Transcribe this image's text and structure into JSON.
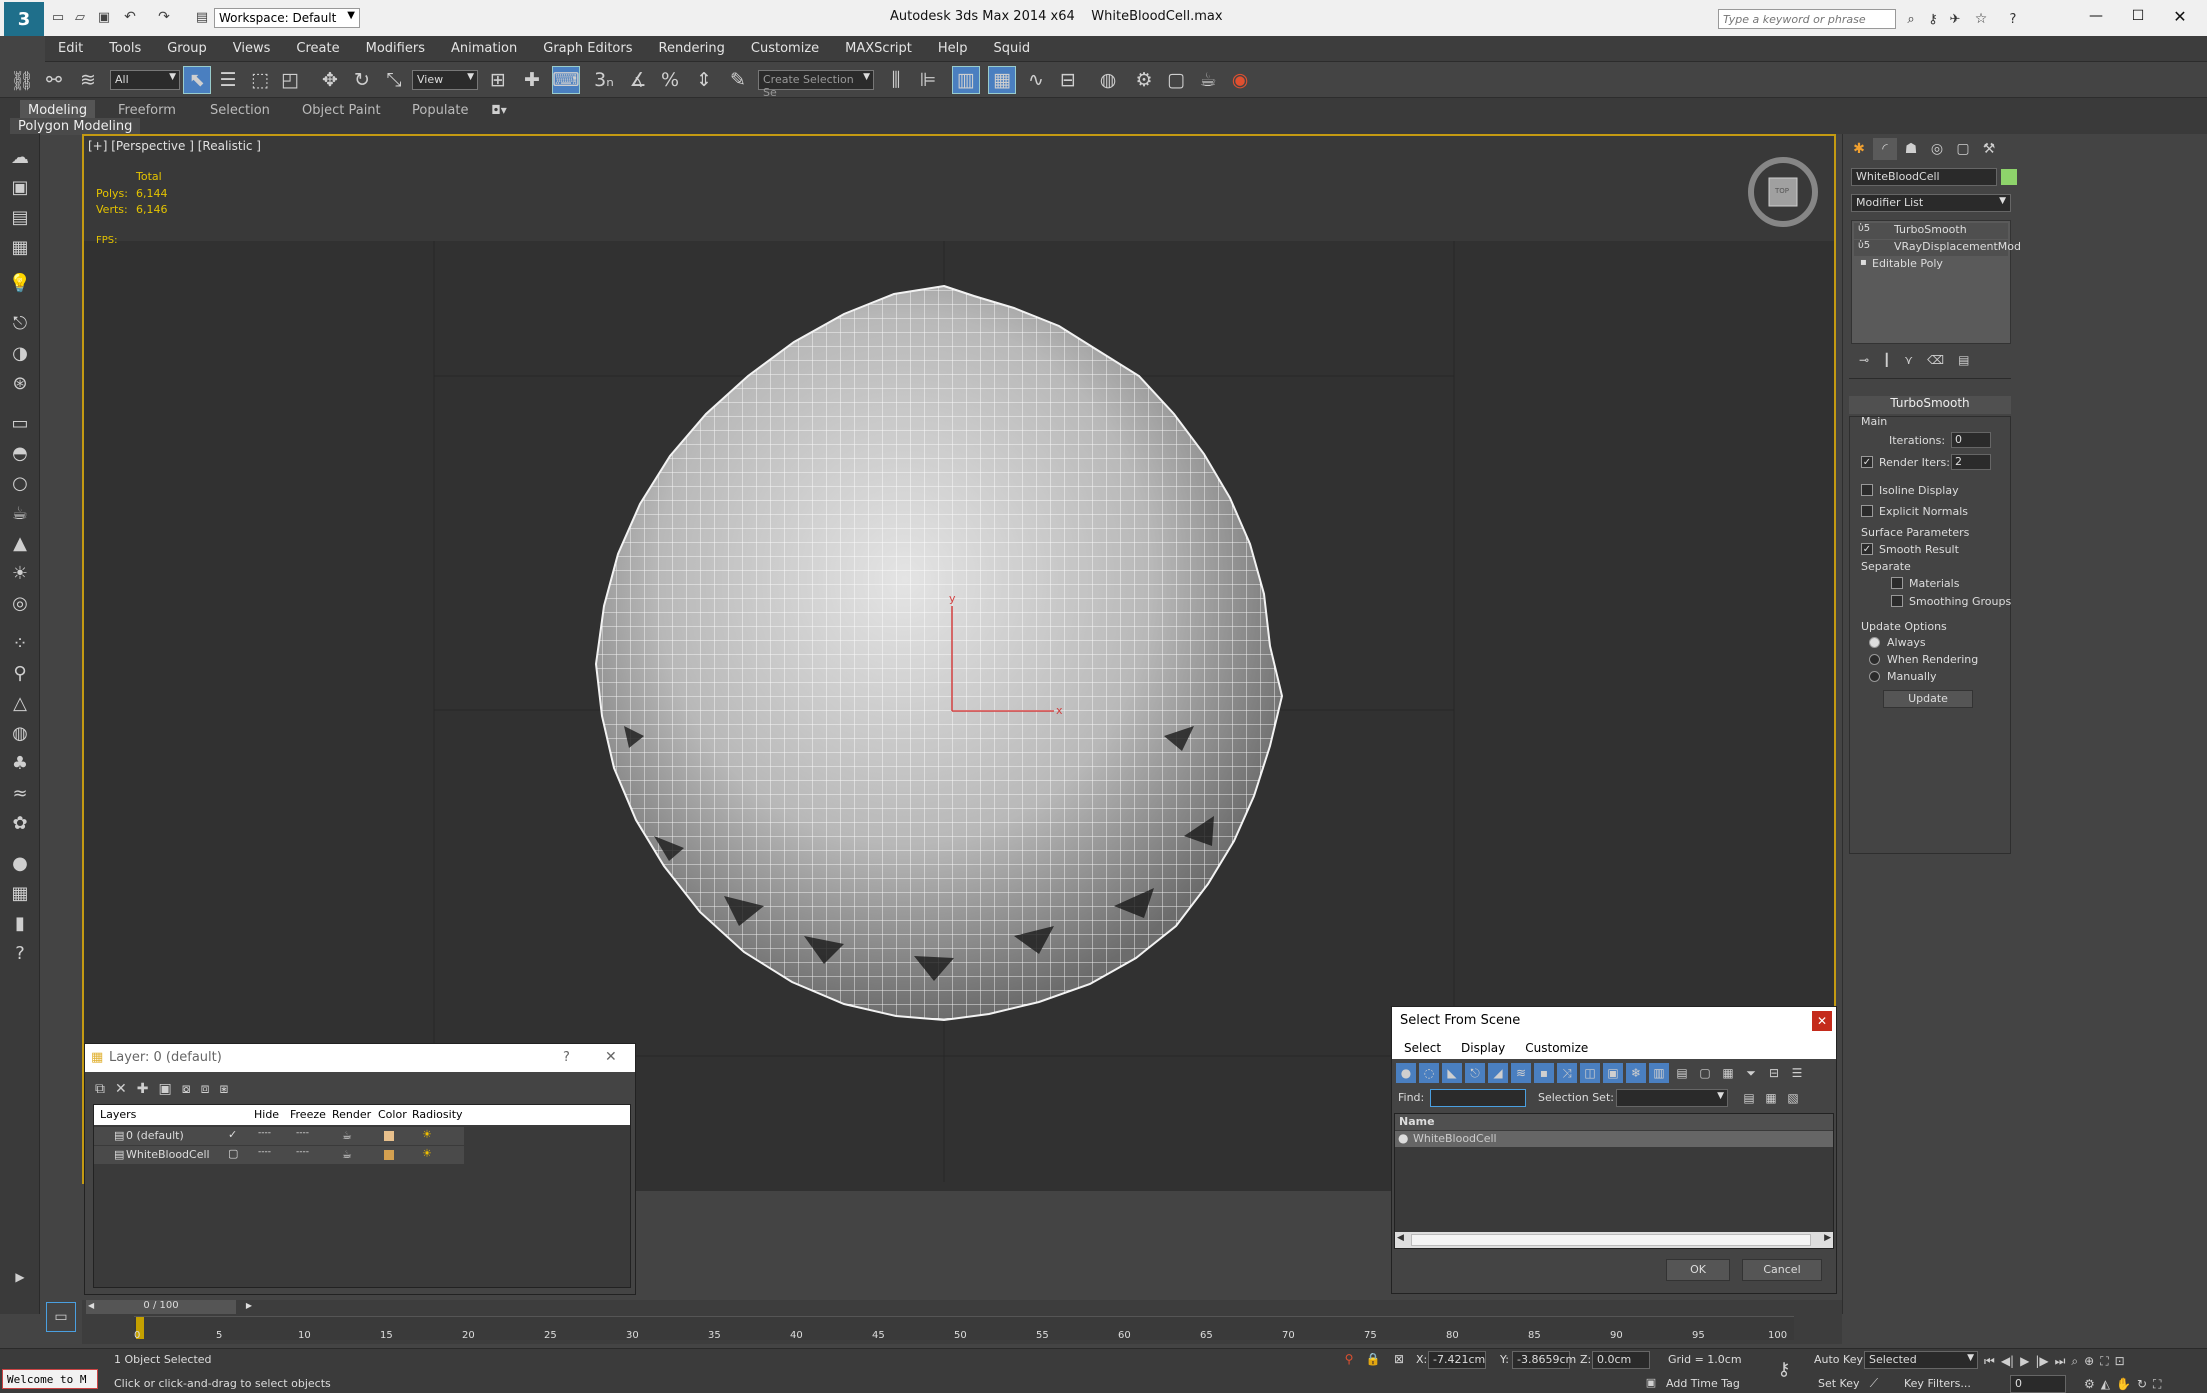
{
  "title": {
    "app": "Autodesk 3ds Max  2014 x64",
    "file": "WhiteBloodCell.max",
    "workspace": "Workspace: Default",
    "search_placeholder": "Type a keyword or phrase"
  },
  "menu": [
    "Edit",
    "Tools",
    "Group",
    "Views",
    "Create",
    "Modifiers",
    "Animation",
    "Graph Editors",
    "Rendering",
    "Customize",
    "MAXScript",
    "Help",
    "Squid"
  ],
  "toolbar": {
    "selection_filter": "All",
    "ref_coord": "View",
    "named_selection": "Create Selection Se"
  },
  "ribbon": {
    "tabs": [
      "Modeling",
      "Freeform",
      "Selection",
      "Object Paint",
      "Populate"
    ],
    "sub": "Polygon Modeling"
  },
  "viewport": {
    "label": "[+] [Perspective ] [Realistic ]",
    "stats": {
      "total": "Total",
      "polys_label": "Polys:",
      "polys": "6,144",
      "verts_label": "Verts:",
      "verts": "6,146",
      "fps": "FPS:"
    },
    "viewcube": "TOP"
  },
  "command_panel": {
    "object_name": "WhiteBloodCell",
    "object_color": "#8ed36b",
    "modifier_list": "Modifier List",
    "stack": [
      "TurboSmooth",
      "VRayDisplacementMod",
      "Editable Poly"
    ],
    "rollout": "TurboSmooth",
    "main": "Main",
    "iterations_label": "Iterations:",
    "iterations": "0",
    "render_iters_label": "Render Iters:",
    "render_iters": "2",
    "isoline": "Isoline Display",
    "explicit_normals": "Explicit Normals",
    "surface_params": "Surface Parameters",
    "smooth_result": "Smooth Result",
    "separate": "Separate",
    "materials": "Materials",
    "smoothing_groups": "Smoothing Groups",
    "update_options": "Update Options",
    "always": "Always",
    "when_rendering": "When Rendering",
    "manually": "Manually",
    "update_button": "Update"
  },
  "layer_dialog": {
    "title": "Layer: 0 (default)",
    "help": "?",
    "columns": [
      "Layers",
      "Hide",
      "Freeze",
      "Render",
      "Color",
      "Radiosity"
    ],
    "rows": [
      {
        "name": "0 (default)",
        "hide": "----",
        "freeze": "----",
        "color": "#e8c08c"
      },
      {
        "name": "WhiteBloodCell",
        "hide": "----",
        "freeze": "----",
        "color": "#d4a050"
      }
    ]
  },
  "select_dialog": {
    "title": "Select From Scene",
    "menus": [
      "Select",
      "Display",
      "Customize"
    ],
    "find_label": "Find:",
    "selection_set_label": "Selection Set:",
    "column": "Name",
    "items": [
      "WhiteBloodCell"
    ],
    "ok": "OK",
    "cancel": "Cancel"
  },
  "timeline": {
    "frame": "0 / 100",
    "ticks": [
      "0",
      "5",
      "10",
      "15",
      "20",
      "25",
      "30",
      "35",
      "40",
      "45",
      "50",
      "55",
      "60",
      "65",
      "70",
      "75",
      "80",
      "85",
      "90",
      "95",
      "100"
    ]
  },
  "status": {
    "maxscript": "Welcome to M",
    "selected": "1 Object Selected",
    "prompt": "Click or click-and-drag to select objects",
    "x_label": "X:",
    "x": "-7.421cm",
    "y_label": "Y:",
    "y": "-3.8659cm",
    "z_label": "Z:",
    "z": "0.0cm",
    "grid": "Grid = 1.0cm",
    "add_time_tag": "Add Time Tag",
    "auto_key": "Auto Key",
    "set_key": "Set Key",
    "key_mode": "Selected",
    "key_filters": "Key Filters...",
    "frame": "0"
  }
}
